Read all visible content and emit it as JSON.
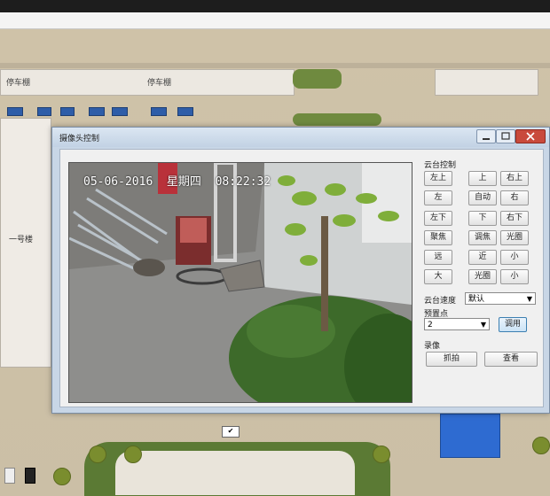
{
  "map": {
    "parking_label_1": "停车棚",
    "parking_label_2": "停车棚",
    "building_label": "一号楼"
  },
  "window": {
    "title": "摄像头控制",
    "controls": [
      "minimize-icon",
      "maximize-icon",
      "close-icon"
    ]
  },
  "video": {
    "timestamp": "05-06-2016  星期四  08:22:32"
  },
  "ptz": {
    "section_label": "云台控制",
    "buttons": [
      {
        "label": "左上"
      },
      {
        "label": "上"
      },
      {
        "label": "右上"
      },
      {
        "label": "左"
      },
      {
        "label": "自动"
      },
      {
        "label": "右"
      },
      {
        "label": "左下"
      },
      {
        "label": "下"
      },
      {
        "label": "右下"
      },
      {
        "label": "聚焦"
      },
      {
        "label": "调焦"
      },
      {
        "label": "光圈"
      },
      {
        "label": "远"
      },
      {
        "label": "近"
      },
      {
        "label": "小"
      },
      {
        "label": "大"
      },
      {
        "label": "光圈"
      },
      {
        "label": "小"
      }
    ],
    "speed_label": "云台速度",
    "speed_value": "默认",
    "preset_label": "预置点",
    "preset_value": "2",
    "goto_button": "调用",
    "record_label": "录像",
    "record_button": "抓拍",
    "view_button": "查看"
  }
}
